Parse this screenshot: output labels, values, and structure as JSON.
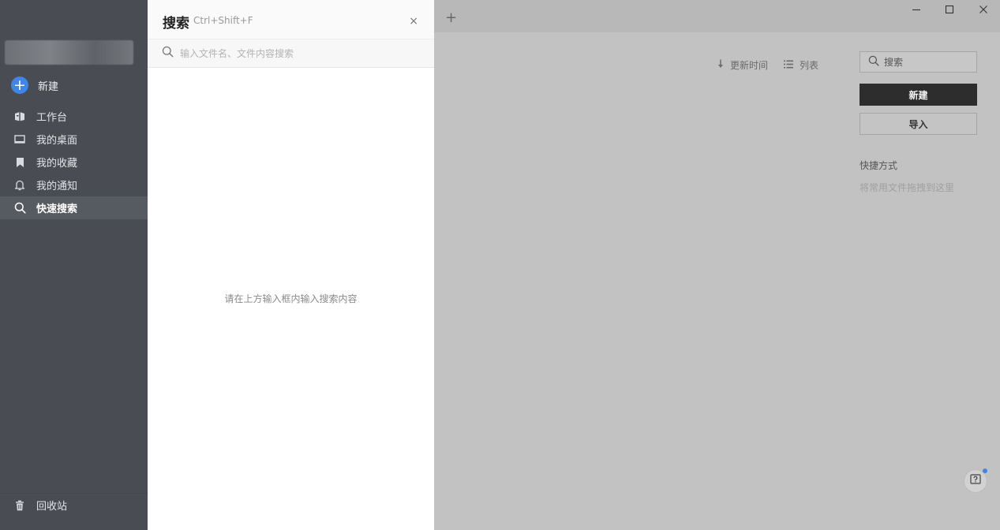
{
  "sidebar": {
    "new_label": "新建",
    "items": [
      {
        "label": "工作台",
        "icon": "workbench-icon"
      },
      {
        "label": "我的桌面",
        "icon": "desktop-icon"
      },
      {
        "label": "我的收藏",
        "icon": "bookmark-icon"
      },
      {
        "label": "我的通知",
        "icon": "bell-icon"
      },
      {
        "label": "快速搜索",
        "icon": "search-icon",
        "active": true
      }
    ],
    "trash_label": "回收站"
  },
  "search_panel": {
    "title": "搜索",
    "shortcut": "Ctrl+Shift+F",
    "close_glyph": "×",
    "placeholder": "输入文件名、文件内容搜索",
    "empty_hint": "请在上方输入框内输入搜索内容"
  },
  "tabbar": {
    "add_glyph": "+"
  },
  "toolbar": {
    "sort_label": "更新时间",
    "view_label": "列表"
  },
  "right_panel": {
    "search_label": "搜索",
    "new_button": "新建",
    "import_button": "导入",
    "shortcut_title": "快捷方式",
    "shortcut_hint": "将常用文件拖拽到这里"
  },
  "colors": {
    "sidebar_bg": "#494d53",
    "accent": "#3f86e8",
    "primary_button": "#2d2d2d"
  }
}
